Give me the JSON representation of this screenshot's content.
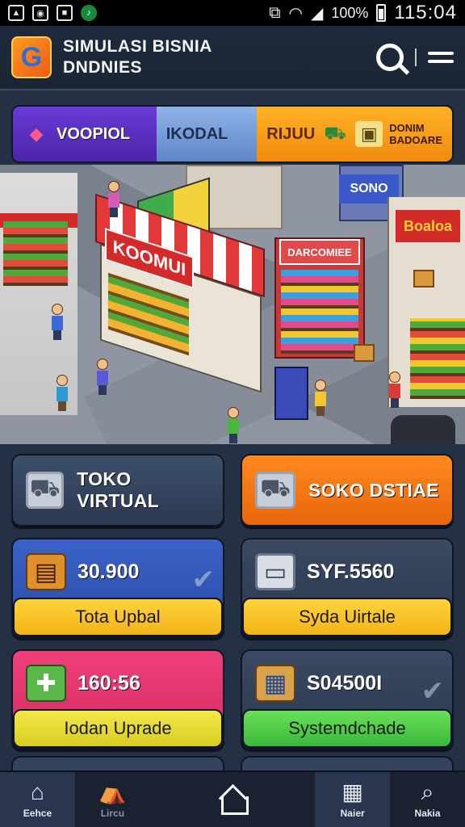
{
  "status_bar": {
    "battery": "100%",
    "time": "115:04"
  },
  "header": {
    "title_line1": "SIMULASI BISNIA",
    "title_line2": "DNDNIES",
    "logo_letter": "G"
  },
  "tabs": [
    {
      "label": "VOOPIOL",
      "icon": "tag-icon"
    },
    {
      "label": "IKODAL",
      "icon": "cart-icon"
    },
    {
      "label": "RIJUU",
      "sub1": "DONIM",
      "sub2": "BADOARE",
      "icon": "box-icon"
    }
  ],
  "scene": {
    "main_shop_sign": "KOOMUI",
    "right_shop_sign": "DARCOMIEE",
    "blue_sign": "SONO",
    "right_sign": "Boaloa"
  },
  "cards": {
    "store_virtual": {
      "label": "TOKO VIRTUAL",
      "icon": "cart-icon"
    },
    "store_orange": {
      "label": "SOKO DSTIAE",
      "icon": "cart-icon"
    },
    "stat1": {
      "value": "30.900",
      "button": "Tota Upbal",
      "icon": "box-icon"
    },
    "stat2": {
      "value": "SYF.5560",
      "button": "Syda Uirtale",
      "icon": "tv-icon"
    },
    "stat3": {
      "value": "160:56",
      "button": "Iodan Uprade",
      "icon": "gift-icon"
    },
    "stat4": {
      "value": "S04500I",
      "button": "Systemdchade",
      "icon": "parcel-icon"
    }
  },
  "bottom_nav": [
    {
      "label": "Eehce",
      "icon": "home-icon"
    },
    {
      "label": "Lircu",
      "icon": "tent-icon"
    },
    {
      "label": "",
      "icon": "home-outline-icon"
    },
    {
      "label": "Naier",
      "icon": "grid-icon"
    },
    {
      "label": "Nakia",
      "icon": "search-icon"
    }
  ],
  "colors": {
    "background": "#243044",
    "accent_orange": "#ff8a1e",
    "accent_blue": "#3a62c8",
    "accent_pink": "#f0407a",
    "button_yellow": "#ffd33a",
    "button_green": "#6ae05a"
  }
}
